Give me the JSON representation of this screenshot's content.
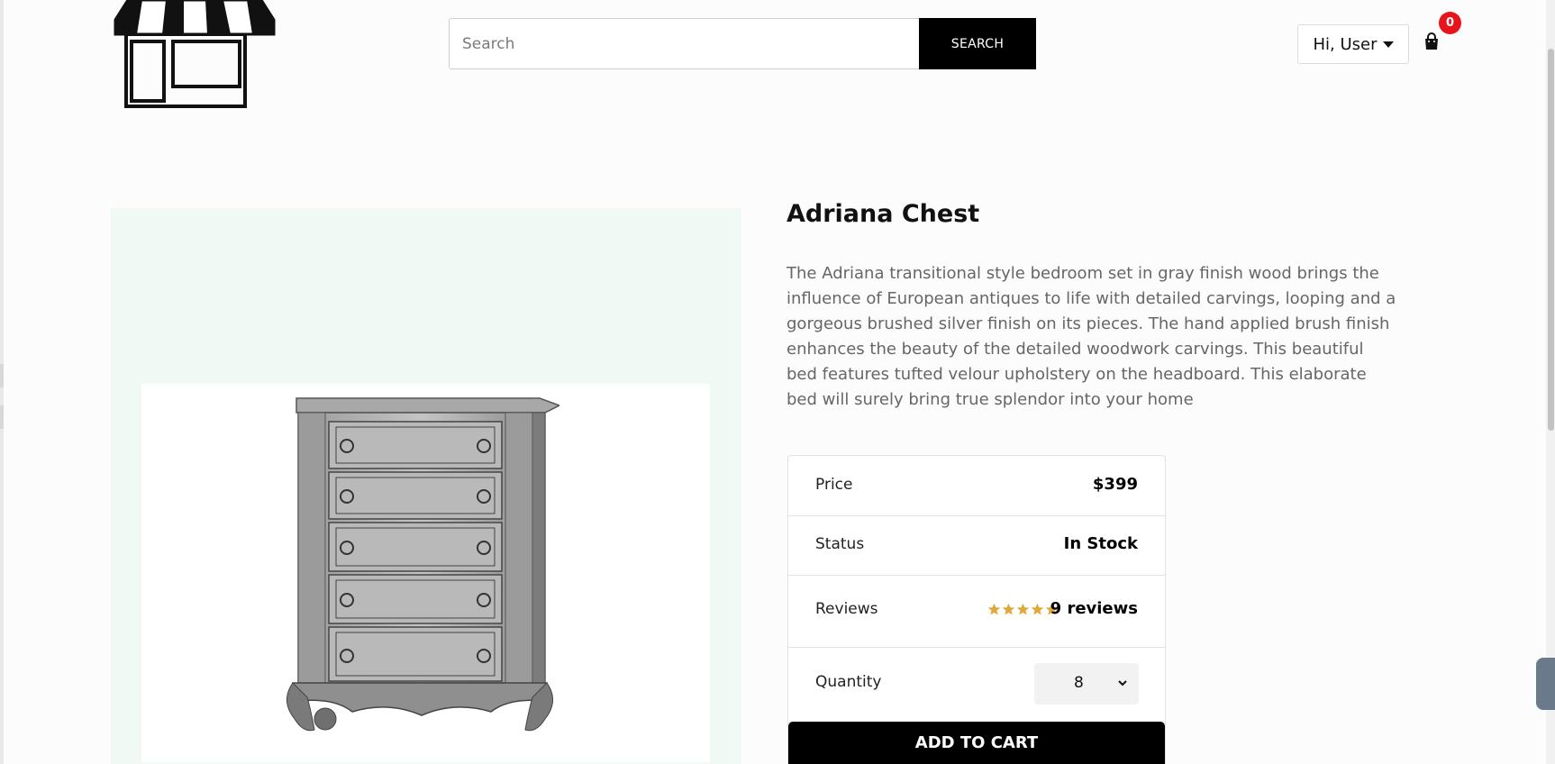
{
  "header": {
    "search": {
      "placeholder": "Search",
      "value": "",
      "button_label": "SEARCH"
    },
    "user_menu_label": "Hi, User",
    "cart_count": "0"
  },
  "product": {
    "title": "Adriana Chest",
    "description": "The Adriana transitional style bedroom set in gray finish wood brings the influence of European antiques to life with detailed carvings, looping and a gorgeous brushed silver finish on its pieces. The hand applied brush finish enhances the beauty of the detailed woodwork carvings. This beautiful bed features tufted velour upholstery on the headboard. This elaborate bed will surely bring true splendor into your home",
    "details": {
      "price_label": "Price",
      "price_value": "$399",
      "status_label": "Status",
      "status_value": "In Stock",
      "reviews_label": "Reviews",
      "rating": 5,
      "reviews_value": "9 reviews",
      "quantity_label": "Quantity",
      "quantity_value": "8"
    },
    "add_to_cart_label": "ADD TO CART"
  },
  "colors": {
    "accent": "#000000",
    "badge": "#e8141b",
    "star": "#e0a93a",
    "image_panel_bg": "#f1f9f5"
  }
}
